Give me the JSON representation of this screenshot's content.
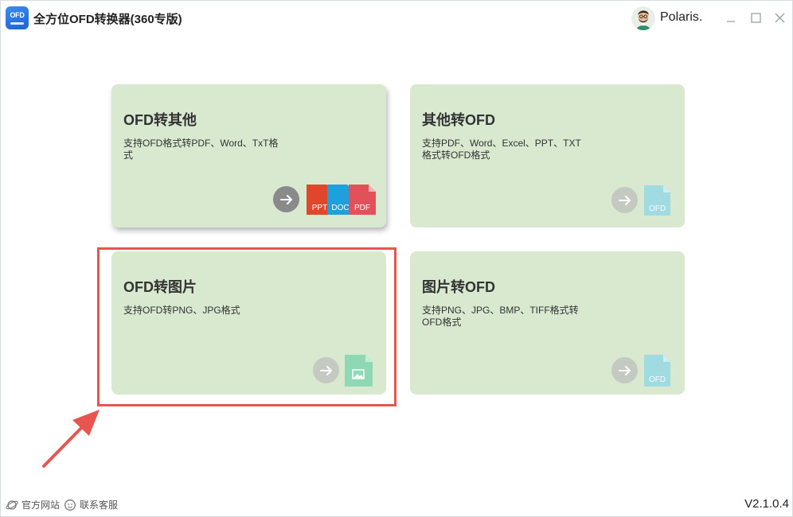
{
  "app": {
    "logo_text": "OFD",
    "title": "全方位OFD转换器(360专版)",
    "username": "Polaris.",
    "window_controls": [
      "minimize-icon",
      "maximize-icon",
      "close-icon"
    ]
  },
  "cards": [
    {
      "title": "OFD转其他",
      "description": "支持OFD格式转PDF、Word、TxT格式",
      "file_icons": [
        {
          "label": "PPT",
          "color": "#e0462a"
        },
        {
          "label": "DOC",
          "color": "#1ea0dd"
        },
        {
          "label": "PDF",
          "color": "#e0515a"
        }
      ]
    },
    {
      "title": "其他转OFD",
      "description": "支持PDF、Word、Excel、PPT、TXT格式转OFD格式",
      "file_icons": [
        {
          "label": "OFD",
          "color": "#9fdbe0"
        }
      ]
    },
    {
      "title": "OFD转图片",
      "description": "支持OFD转PNG、JPG格式",
      "file_icons": [
        {
          "label": "image-icon",
          "color": "#8ed9b4"
        }
      ]
    },
    {
      "title": "图片转OFD",
      "description": "支持PNG、JPG、BMP、TIFF格式转OFD格式",
      "file_icons": [
        {
          "label": "OFD",
          "color": "#9fdbe0"
        }
      ]
    }
  ],
  "footer": {
    "website_label": "官方网站",
    "support_label": "联系客服",
    "version": "V2.1.0.4"
  },
  "colors": {
    "card_bg": "#d8e9d0",
    "highlight": "#e85450",
    "accent": "#2a78e8"
  }
}
